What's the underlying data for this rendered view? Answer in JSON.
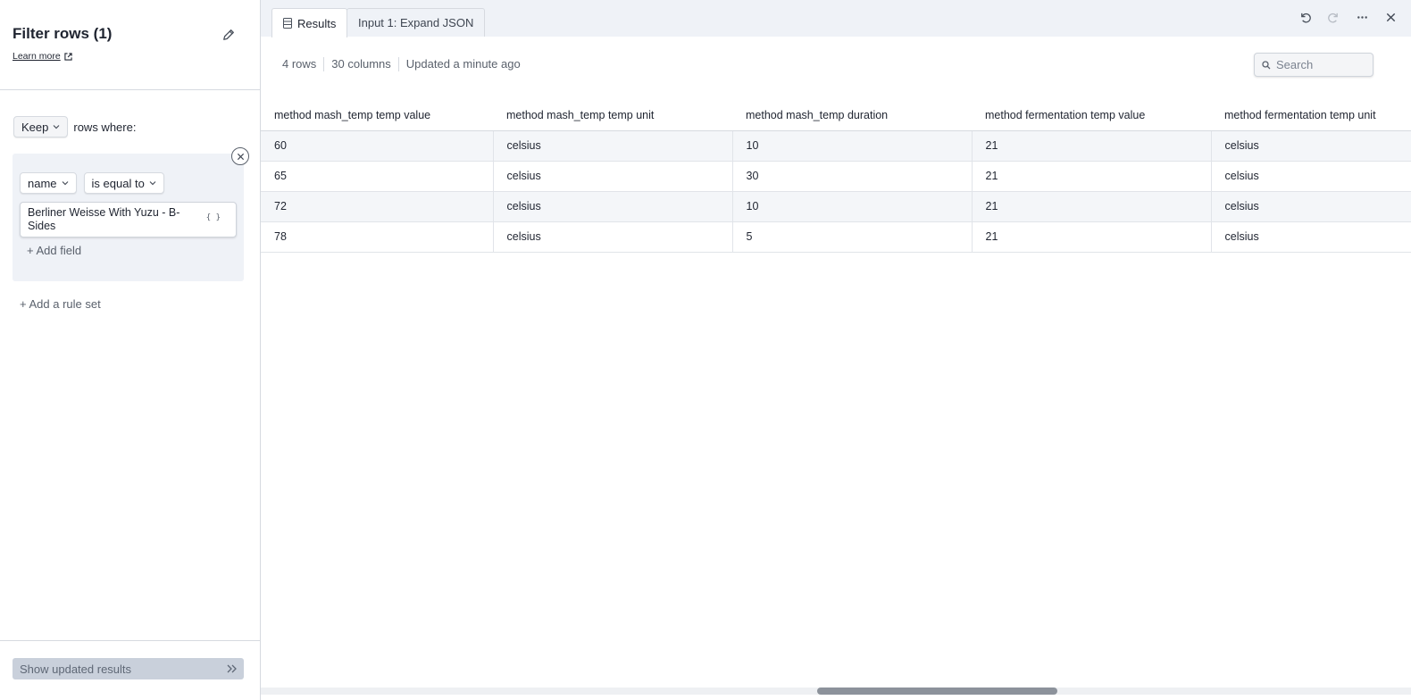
{
  "left_panel": {
    "title": "Filter rows (1)",
    "learn_more": "Learn more",
    "keep_label": "Keep",
    "rows_where": "rows where:",
    "condition": {
      "field": "name",
      "operator": "is equal to",
      "value": "Berliner Weisse With Yuzu - B-Sides",
      "value_mode_icon": "braces-icon"
    },
    "add_field": "+ Add field",
    "add_rule_set": "+ Add a rule set",
    "show_updated_results": "Show updated results"
  },
  "right_panel": {
    "tabs": [
      {
        "label": "Results",
        "icon": "table-icon",
        "active": true
      },
      {
        "label": "Input 1: Expand JSON",
        "active": false
      }
    ],
    "toolbar_icons": [
      "undo-icon",
      "redo-icon",
      "more-icon",
      "close-icon"
    ],
    "meta": {
      "rows": "4 rows",
      "columns": "30 columns",
      "updated": "Updated a minute ago"
    },
    "search": {
      "placeholder": "Search",
      "value": ""
    },
    "table": {
      "columns": [
        "method mash_temp temp value",
        "method mash_temp temp unit",
        "method mash_temp duration",
        "method fermentation temp value",
        "method fermentation temp unit"
      ],
      "rows": [
        [
          "60",
          "celsius",
          "10",
          "21",
          "celsius"
        ],
        [
          "65",
          "celsius",
          "30",
          "21",
          "celsius"
        ],
        [
          "72",
          "celsius",
          "10",
          "21",
          "celsius"
        ],
        [
          "78",
          "celsius",
          "5",
          "21",
          "celsius"
        ]
      ]
    }
  }
}
